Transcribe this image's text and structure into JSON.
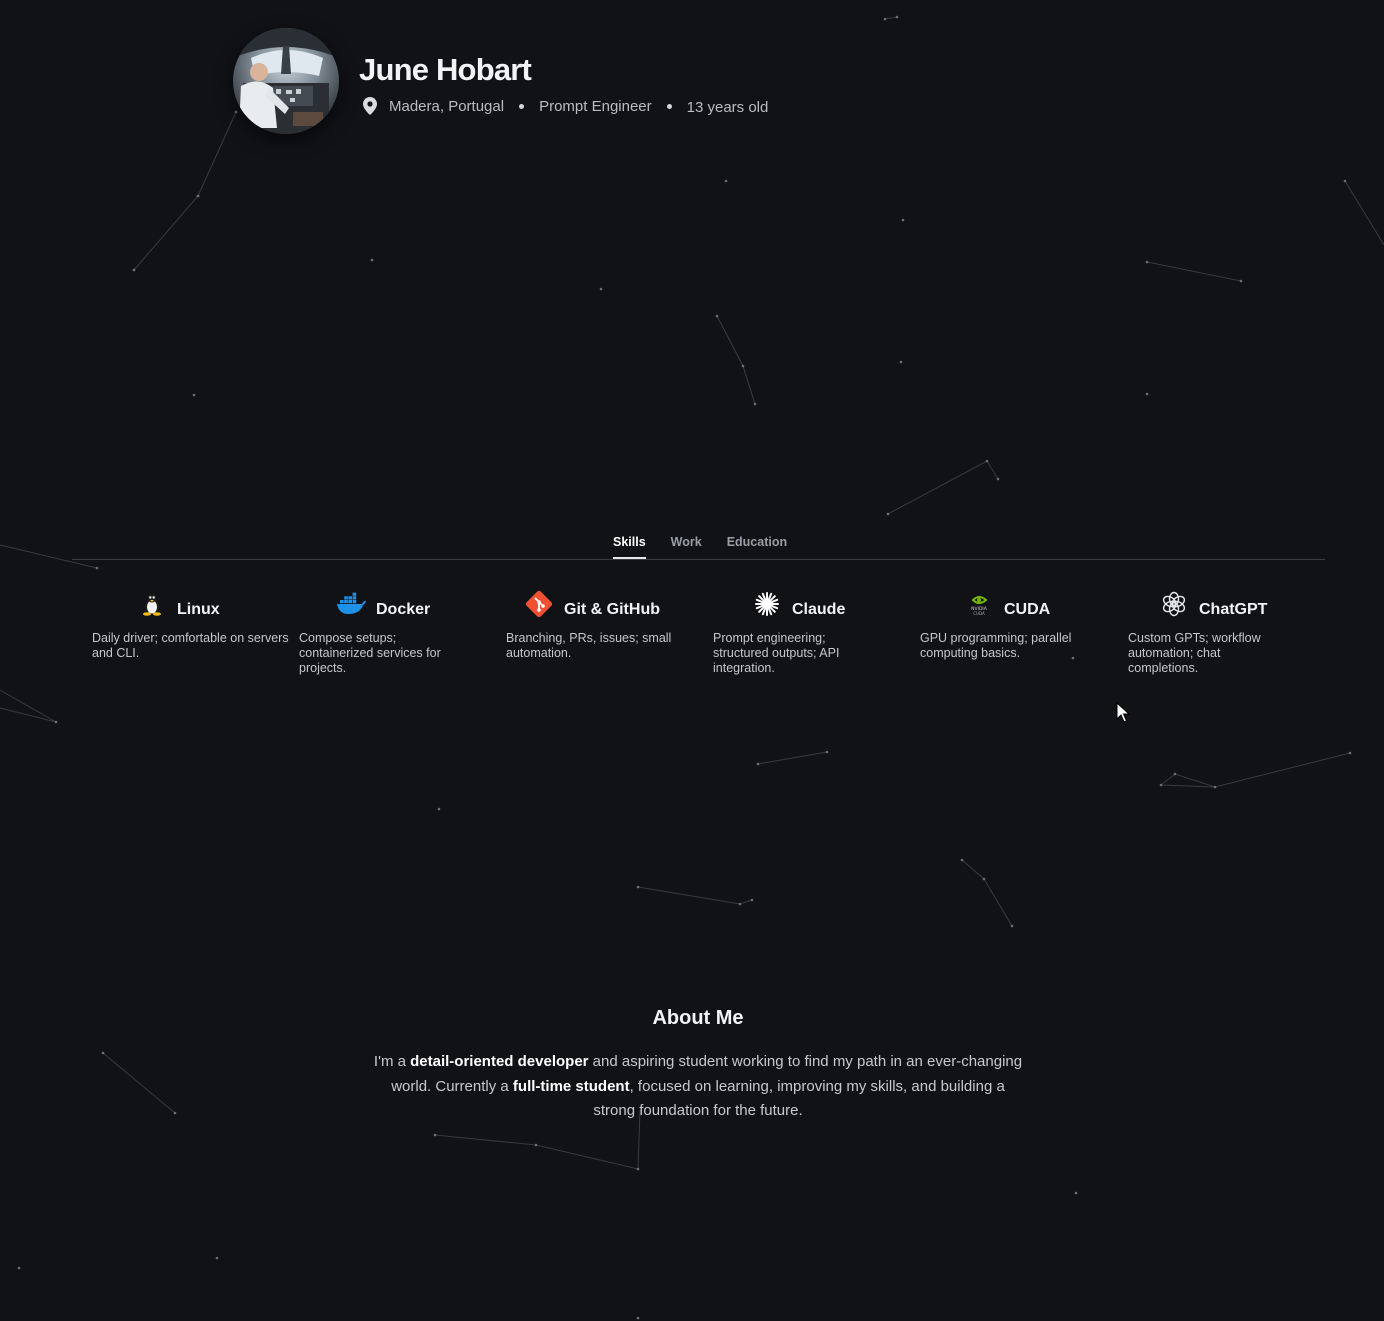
{
  "profile": {
    "name": "June Hobart",
    "location": "Madera, Portugal",
    "role": "Prompt Engineer",
    "age": "13 years old"
  },
  "tabs": [
    {
      "label": "Skills",
      "active": true
    },
    {
      "label": "Work",
      "active": false
    },
    {
      "label": "Education",
      "active": false
    }
  ],
  "skills": [
    {
      "icon": "linux-tux-icon",
      "title": "Linux",
      "desc": "Daily driver; comfortable on servers and CLI."
    },
    {
      "icon": "docker-whale-icon",
      "title": "Docker",
      "desc": "Compose setups; containerized services for projects."
    },
    {
      "icon": "git-logo-icon",
      "title": "Git & GitHub",
      "desc": "Branching, PRs, issues; small automation."
    },
    {
      "icon": "claude-asterisk-icon",
      "title": "Claude",
      "desc": "Prompt engineering; structured outputs; API integration."
    },
    {
      "icon": "nvidia-cuda-icon",
      "title": "CUDA",
      "desc": "GPU programming; parallel computing basics."
    },
    {
      "icon": "openai-logo-icon",
      "title": "ChatGPT",
      "desc": "Custom GPTs; workflow automation; chat completions."
    }
  ],
  "about": {
    "title": "About Me",
    "p1": "I'm a ",
    "b1": "detail-oriented developer",
    "p2": " and aspiring student working to find my path in an ever-changing world. Currently a ",
    "b2": "full-time student",
    "p3": ", focused on learning, improving my skills, and building a strong foundation for the future."
  },
  "colors": {
    "background": "#111216",
    "text": "#e8e9ec",
    "muted": "#b9bcc3",
    "docker": "#1d91e6",
    "git": "#f05133",
    "nvidia": "#76b900"
  }
}
